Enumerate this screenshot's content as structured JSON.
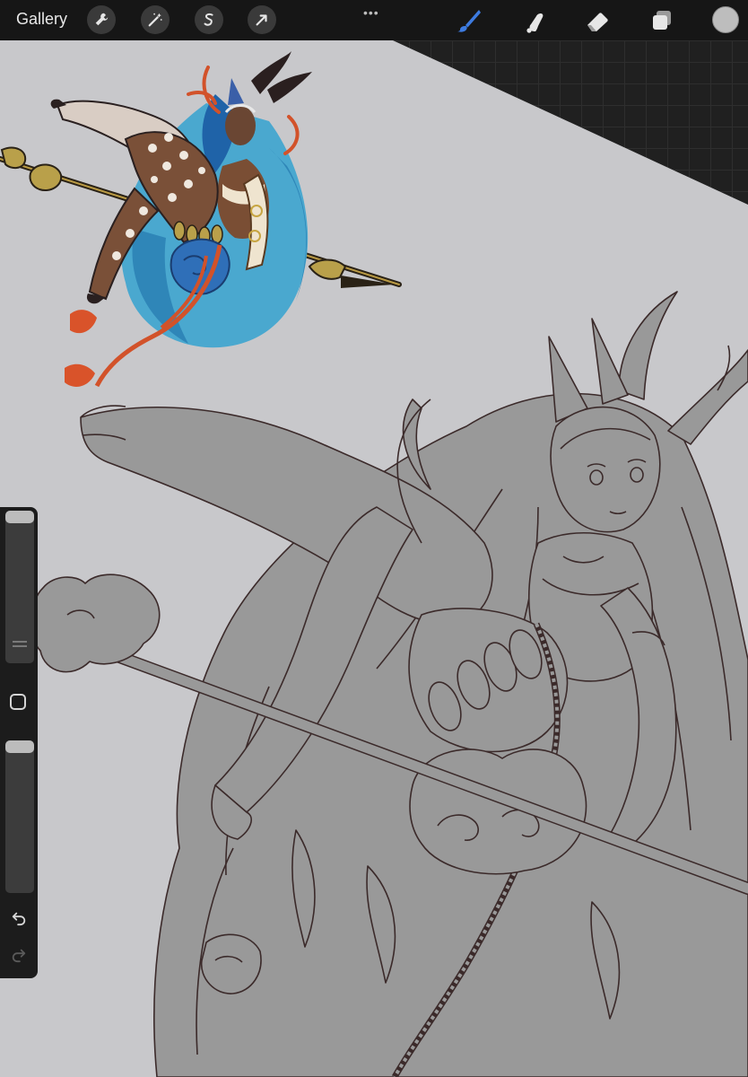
{
  "topbar": {
    "gallery_label": "Gallery",
    "left_tools": [
      "wrench-icon",
      "magic-wand-icon",
      "selection-icon",
      "transform-arrow-icon"
    ],
    "more_label": "•••",
    "right_tools": [
      "brush-icon",
      "smudge-icon",
      "eraser-icon",
      "layers-icon"
    ],
    "active_tool": "brush-icon",
    "accent_color": "#3d7be0",
    "current_color": "#bdbdbd"
  },
  "sidebar": {
    "brush_size_level": 0.05,
    "brush_opacity_level": 0.05,
    "undo_icon": "undo-icon",
    "redo_icon": "redo-icon"
  },
  "canvas": {
    "paper_color": "#c8c8cb",
    "fill_gray": "#999999",
    "line_color": "#3b2a2a"
  }
}
